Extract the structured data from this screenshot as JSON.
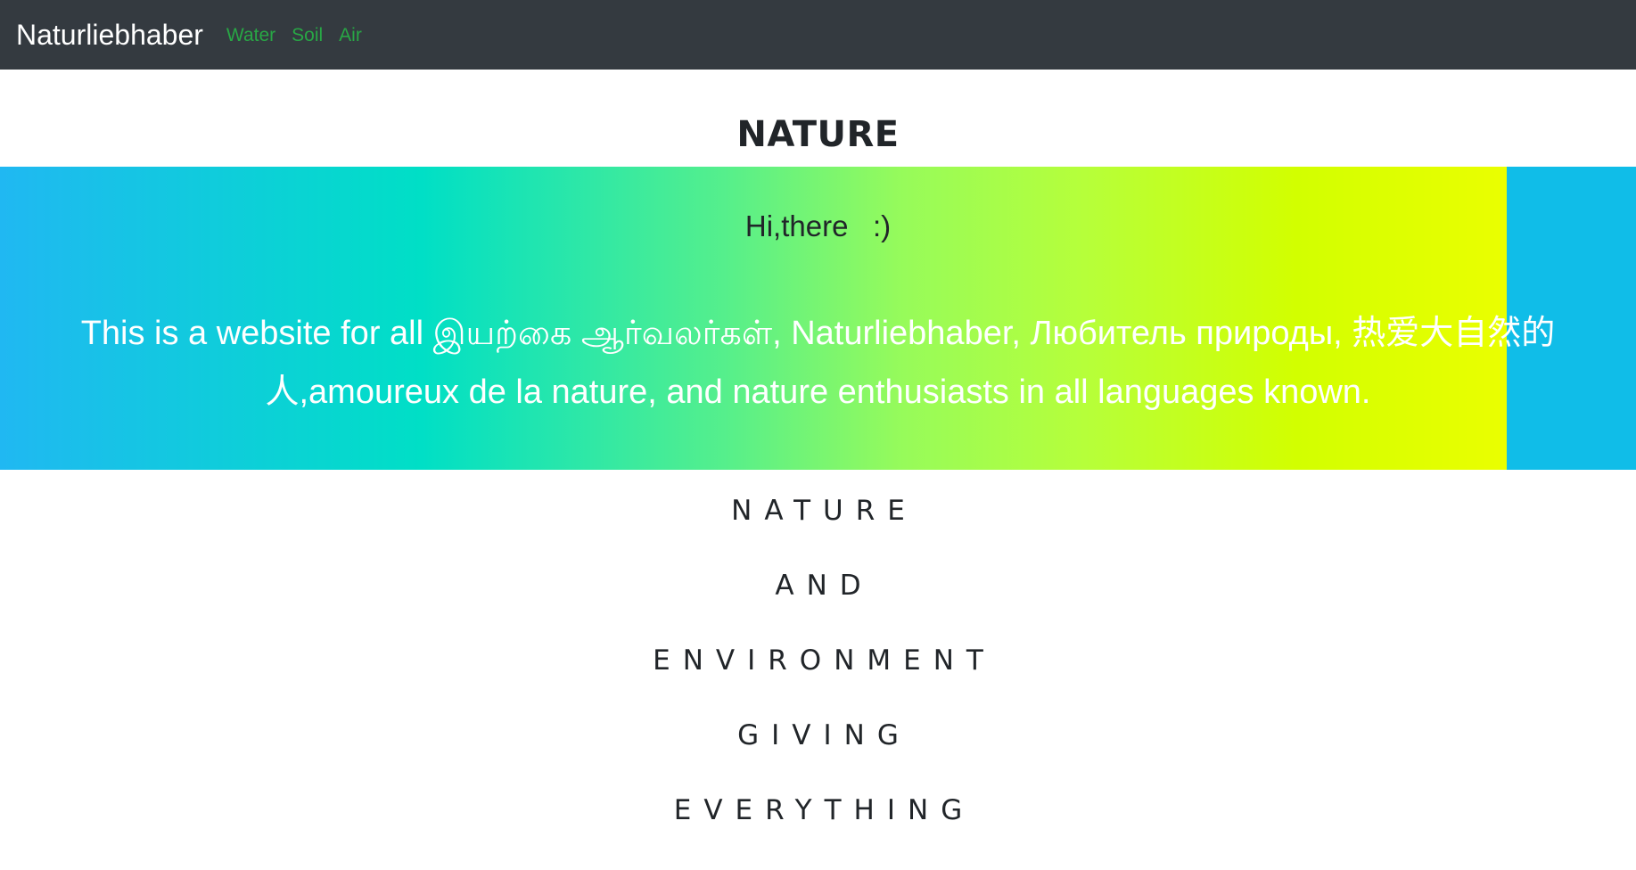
{
  "navbar": {
    "brand": "Naturliebhaber",
    "links": [
      "Water",
      "Soil",
      "Air"
    ],
    "link_color": "#28a745",
    "background": "#343a40"
  },
  "page": {
    "title": "NATURE"
  },
  "hero": {
    "greeting": "Hi,there   :)",
    "text": "This is a website for all இயற்கை ஆர்வலர்கள், Naturliebhaber, Любитель природы, 热爱大自然的人,amoureux de la nature, and nature enthusiasts in all languages known."
  },
  "words": [
    "NATURE",
    "AND",
    "ENVIRONMENT",
    "GIVING",
    "EVERYTHING"
  ]
}
